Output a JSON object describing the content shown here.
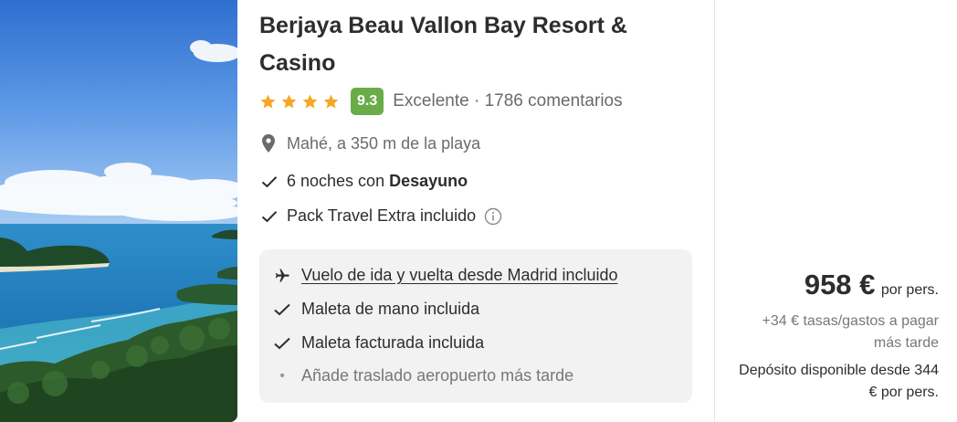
{
  "hotel": {
    "title": "Berjaya Beau Vallon Bay Resort & Casino",
    "stars": 4,
    "score": "9.3",
    "rating_text": "Excelente · 1786 comentarios",
    "location": "Mahé, a 350 m de la playa",
    "features": [
      {
        "text": "6 noches con",
        "bold": "Desayuno"
      },
      {
        "text": "Pack Travel Extra incluido",
        "bold": ""
      }
    ]
  },
  "package": {
    "flight": "Vuelo de ida y vuelta desde Madrid incluido",
    "items": [
      "Maleta de mano incluida",
      "Maleta facturada incluida"
    ],
    "optional": "Añade traslado aeropuerto más tarde"
  },
  "price": {
    "amount": "958 €",
    "per": "por pers.",
    "taxes": "+34 € tasas/gastos a pagar más tarde",
    "deposit": "Depósito disponible desde 344 € por pers."
  },
  "colors": {
    "score_bg": "#6aac48",
    "star": "#f5a623",
    "box_bg": "#f2f2f2"
  },
  "icons": [
    "star-icon",
    "location-pin-icon",
    "check-icon",
    "info-icon",
    "airplane-icon",
    "bullet-dot-icon"
  ]
}
